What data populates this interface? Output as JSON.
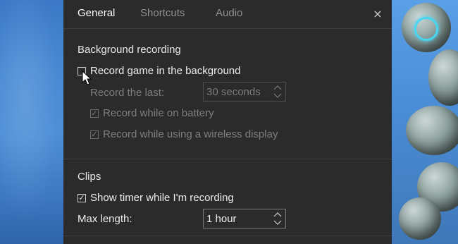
{
  "tabs": [
    {
      "label": "General"
    },
    {
      "label": "Shortcuts"
    },
    {
      "label": "Audio"
    }
  ],
  "close_icon": "×",
  "background_recording": {
    "title": "Background recording",
    "record_game_label": "Record game in the background",
    "record_game_checked": false,
    "record_last_label": "Record the last:",
    "record_last_value": "30 seconds",
    "record_battery_label": "Record while on battery",
    "record_wireless_label": "Record while using a wireless display",
    "check_mark": "✓"
  },
  "clips": {
    "title": "Clips",
    "show_timer_label": "Show timer while I'm recording",
    "max_length_label": "Max length:",
    "max_length_value": "1 hour"
  },
  "colors": {
    "panel_bg": "#2b2b2b",
    "glow": "#48d6f0"
  }
}
